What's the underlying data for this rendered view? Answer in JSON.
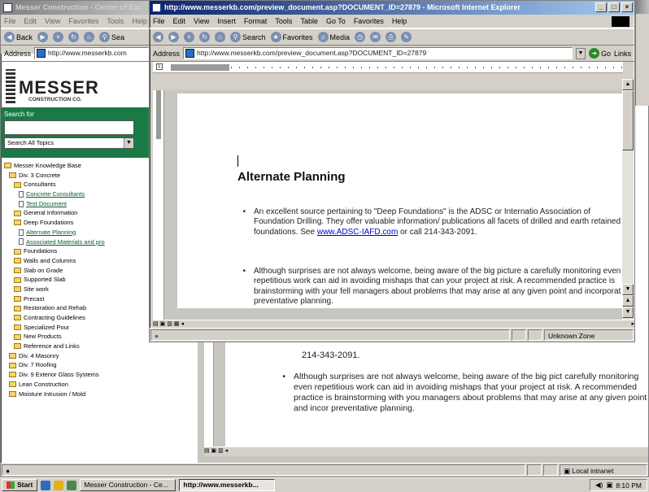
{
  "back_window": {
    "title": "Messer Construction - Center of Exc",
    "menu": [
      "File",
      "Edit",
      "View",
      "Favorites",
      "Tools",
      "Help"
    ],
    "toolbar_back": "Back",
    "toolbar_search": "Sea",
    "address_label": "Address",
    "address_value": "http://www.messerkb.com",
    "logo_name": "MESSER",
    "logo_sub": "CONSTRUCTION CO.",
    "search_label": "Search for",
    "search_value": "",
    "search_scope": "Search All Topics",
    "tree": [
      {
        "label": "Messer Knowledge Base",
        "type": "folder",
        "level": 0
      },
      {
        "label": "Div. 3 Concrete",
        "type": "folder",
        "level": 1
      },
      {
        "label": "Consultants",
        "type": "folder",
        "level": 2
      },
      {
        "label": "Concrete Consultants",
        "type": "link",
        "level": 3
      },
      {
        "label": "Test Document",
        "type": "link",
        "level": 3
      },
      {
        "label": "General Information",
        "type": "folder",
        "level": 2
      },
      {
        "label": "Deep Foundations",
        "type": "folder",
        "level": 2
      },
      {
        "label": "Alternate Planning",
        "type": "link",
        "level": 3
      },
      {
        "label": "Associated Materials and pro",
        "type": "link",
        "level": 3
      },
      {
        "label": "Foundations",
        "type": "folder",
        "level": 2
      },
      {
        "label": "Walls and Columns",
        "type": "folder",
        "level": 2
      },
      {
        "label": "Slab on Grade",
        "type": "folder",
        "level": 2
      },
      {
        "label": "Supported Slab",
        "type": "folder",
        "level": 2
      },
      {
        "label": "Site work",
        "type": "folder",
        "level": 2
      },
      {
        "label": "Precast",
        "type": "folder",
        "level": 2
      },
      {
        "label": "Restoration and Rehab",
        "type": "folder",
        "level": 2
      },
      {
        "label": "Contracting Guidelines",
        "type": "folder",
        "level": 2
      },
      {
        "label": "Specialized Pour",
        "type": "folder",
        "level": 2
      },
      {
        "label": "New Products",
        "type": "folder",
        "level": 2
      },
      {
        "label": "Reference and Links",
        "type": "folder",
        "level": 2
      },
      {
        "label": "Div. 4 Masonry",
        "type": "folder",
        "level": 1
      },
      {
        "label": "Div. 7 Roofing",
        "type": "folder",
        "level": 1
      },
      {
        "label": "Div. 9 Exterior Glass Systems",
        "type": "folder",
        "level": 1
      },
      {
        "label": "Lean Construction",
        "type": "folder",
        "level": 1
      },
      {
        "label": "Moisture Intrusion / Mold",
        "type": "folder",
        "level": 1
      }
    ],
    "content_phone_tail": "214-343-2091.",
    "content_bullet2": "Although surprises are not always welcome, being aware of the big pict carefully monitoring even repetitious work can aid in avoiding mishaps that your project at risk. A recommended practice is brainstorming with you managers about problems that may arise at any given point and incor preventative planning.",
    "right_edge_text": "ut",
    "status_zone": "Local intranet"
  },
  "front_window": {
    "title": "http://www.messerkb.com/preview_document.asp?DOCUMENT_ID=27879 - Microsoft Internet Explorer",
    "menu": [
      "File",
      "Edit",
      "View",
      "Insert",
      "Format",
      "Tools",
      "Table",
      "Go To",
      "Favorites",
      "Help"
    ],
    "toolbar_search": "Search",
    "toolbar_favorites": "Favorites",
    "toolbar_media": "Media",
    "address_label": "Address",
    "address_value": "http://www.messerkb.com/preview_document.asp?DOCUMENT_ID=27879",
    "go_label": "Go",
    "links_label": "Links",
    "doc_heading": "Alternate Planning",
    "bullet1_text": "An excellent source pertaining to \"Deep Foundations\" is the ADSC or Internatio Association of Foundation Drilling. They offer valuable information/ publications all facets of drilled and earth retained foundations. See ",
    "bullet1_link": "www.ADSC-IAFD.com",
    "bullet1_tail": " or call 214-343-2091.",
    "bullet2_text": "Although surprises are not always welcome, being aware of the big picture a carefully monitoring even repetitious work can aid in avoiding mishaps that can your project at risk. A recommended practice is brainstorming with your fell managers about problems that may arise at any given point and incorporat preventative planning.",
    "status_zone": "Unknown Zone"
  },
  "taskbar": {
    "start_label": "Start",
    "task1": "Messer Construction - Ce...",
    "task2": "http://www.messerkb...",
    "clock": "8:10 PM"
  }
}
